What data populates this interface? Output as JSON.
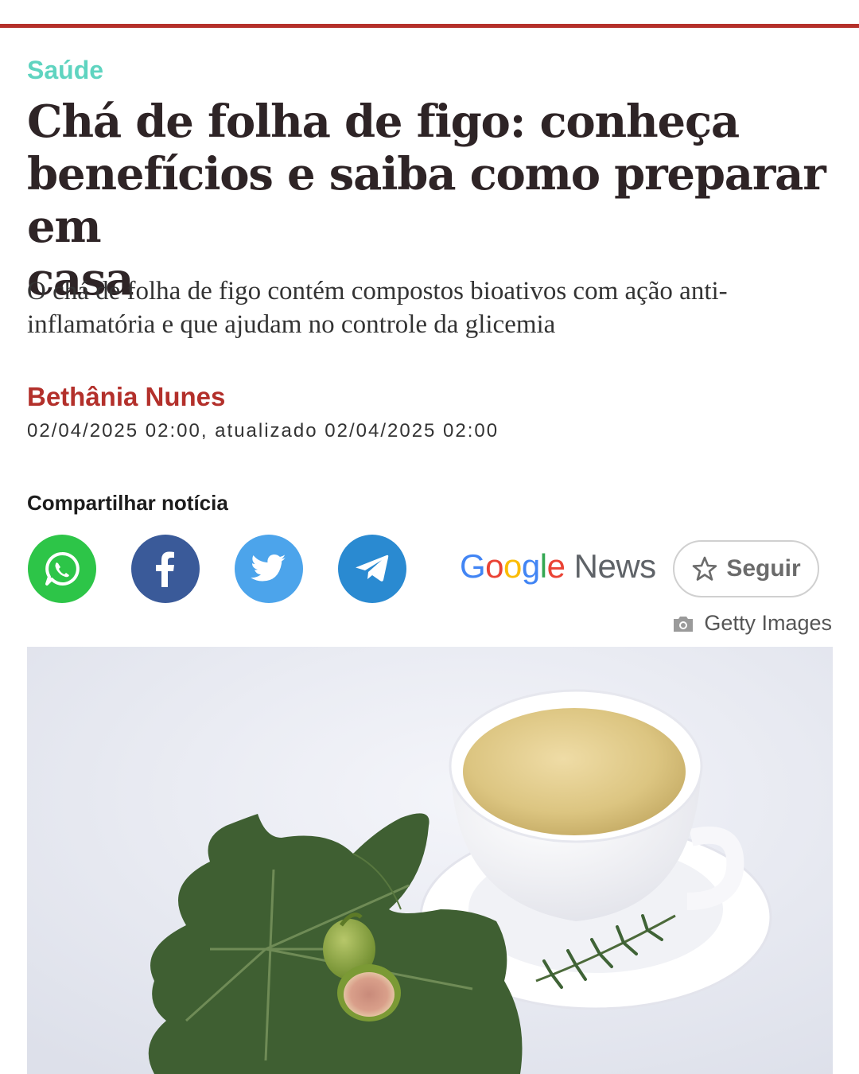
{
  "article": {
    "category": "Saúde",
    "headline_lines": [
      "Chá de folha de figo: conheça",
      "benefícios e saiba como preparar em",
      "casa"
    ],
    "subtitle": "O chá de folha de figo contém compostos bioativos com ação anti-inflamatória e que ajudam no controle da glicemia",
    "author": "Bethânia Nunes",
    "date": "02/04/2025 02:00, atualizado 02/04/2025 02:00"
  },
  "share": {
    "label": "Compartilhar notícia",
    "buttons": [
      {
        "icon": "whatsapp-icon",
        "color": "#2dc548"
      },
      {
        "icon": "facebook-icon",
        "color": "#3a5a99"
      },
      {
        "icon": "twitter-icon",
        "color": "#4ca4eb"
      },
      {
        "icon": "telegram-icon",
        "color": "#2a8ad1"
      }
    ]
  },
  "google_news": {
    "logo_google": "Google",
    "logo_news": "News",
    "follow_label": "Seguir"
  },
  "image": {
    "credit": "Getty Images",
    "icon": "camera-icon"
  },
  "colors": {
    "accent_red": "#b3302b",
    "category_teal": "#5fd4c0",
    "headline": "#2e2426"
  }
}
